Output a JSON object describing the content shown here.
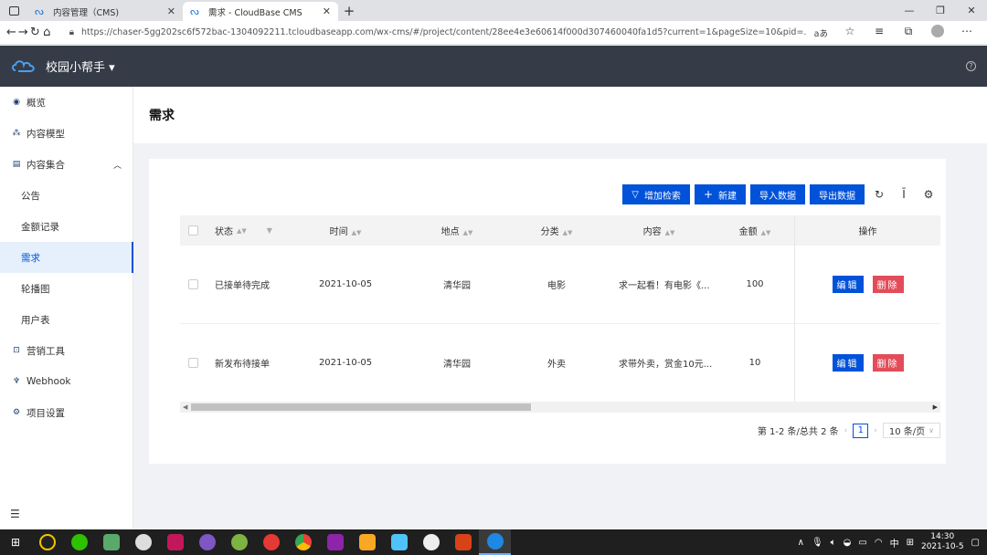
{
  "browser": {
    "tabs": [
      {
        "title": "内容管理（CMS)",
        "close": "✕"
      },
      {
        "title": "需求 - CloudBase CMS",
        "close": "✕"
      }
    ],
    "new_tab": "+",
    "window_controls": [
      "—",
      "❐",
      "✕"
    ],
    "url": "https://chaser-5gg202sc6f572bac-1304092211.tcloudbaseapp.com/wx-cms/#/project/content/28ee4e3e60614f000d307460040fa1d5?current=1&pageSize=10&pid=...",
    "read_aloud": "aあ"
  },
  "app": {
    "title": "校园小帮手",
    "title_caret": "▾",
    "help": "?"
  },
  "sidebar": {
    "items": [
      {
        "label": "概览",
        "icon": "◉"
      },
      {
        "label": "内容模型",
        "icon": "⁂"
      },
      {
        "label": "内容集合",
        "icon": "▤",
        "caret": "︿"
      },
      {
        "label": "公告"
      },
      {
        "label": "金额记录"
      },
      {
        "label": "需求"
      },
      {
        "label": "轮播图"
      },
      {
        "label": "用户表"
      },
      {
        "label": "营销工具",
        "icon": "⊡"
      },
      {
        "label": "Webhook",
        "icon": "♆"
      },
      {
        "label": "项目设置",
        "icon": "⚙"
      }
    ],
    "collapse": "☰"
  },
  "page": {
    "title": "需求"
  },
  "toolbar": {
    "add_search": "增加检索",
    "create": "新建",
    "import": "导入数据",
    "export": "导出数据",
    "create_prefix": "+",
    "filter_prefix": "▽"
  },
  "table": {
    "headers": {
      "status": "状态",
      "time": "时间",
      "location": "地点",
      "category": "分类",
      "content": "内容",
      "amount": "金额",
      "actions": "操作"
    },
    "rows": [
      {
        "status": "已接单待完成",
        "time": "2021-10-05",
        "location": "清华园",
        "category": "电影",
        "content": "求一起看！有电影《...",
        "amount": "100",
        "edit": "编辑",
        "delete": "删除"
      },
      {
        "status": "新发布待接单",
        "time": "2021-10-05",
        "location": "清华园",
        "category": "外卖",
        "content": "求带外卖，赏金10元...",
        "amount": "10",
        "edit": "编辑",
        "delete": "删除"
      }
    ]
  },
  "pagination": {
    "summary": "第 1-2 条/总共 2 条",
    "current": "1",
    "page_size": "10 条/页",
    "prev": "‹",
    "next": "›"
  },
  "taskbar": {
    "lang": "中",
    "ime": "⊞",
    "time": "14:30",
    "date": "2021-10-5",
    "tray_up": "∧"
  },
  "colors": {
    "primary": "#0052d9",
    "danger": "#e34d59",
    "header_bg": "#353c47"
  }
}
